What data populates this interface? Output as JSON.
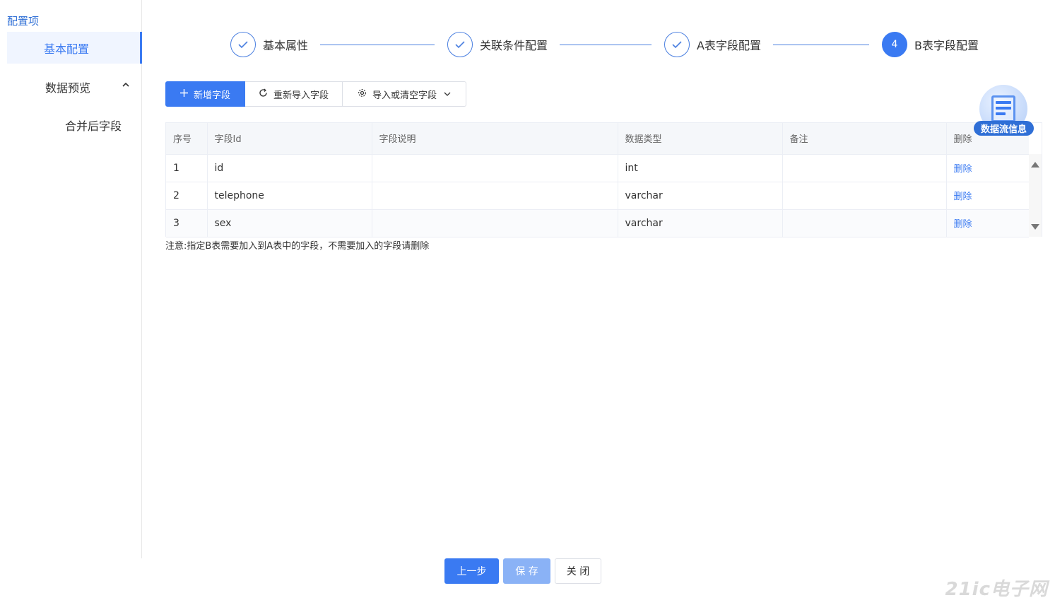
{
  "sidebar": {
    "heading": "配置项",
    "items": [
      {
        "label": "基本配置",
        "active": true
      },
      {
        "label": "数据预览",
        "expanded": true
      },
      {
        "label": "合并后字段"
      }
    ]
  },
  "steps": [
    {
      "label": "基本属性",
      "status": "done"
    },
    {
      "label": "关联条件配置",
      "status": "done"
    },
    {
      "label": "A表字段配置",
      "status": "done"
    },
    {
      "label": "B表字段配置",
      "status": "current",
      "number": "4"
    }
  ],
  "toolbar": {
    "add_label": "新增字段",
    "reimport_label": "重新导入字段",
    "import_label": "导入或清空字段"
  },
  "table": {
    "columns": [
      "序号",
      "字段Id",
      "字段说明",
      "数据类型",
      "备注",
      "删除"
    ],
    "rows": [
      {
        "index": "1",
        "field_id": "id",
        "desc": "",
        "type": "int",
        "remark": "",
        "action": "删除"
      },
      {
        "index": "2",
        "field_id": "telephone",
        "desc": "",
        "type": "varchar",
        "remark": "",
        "action": "删除"
      },
      {
        "index": "3",
        "field_id": "sex",
        "desc": "",
        "type": "varchar",
        "remark": "",
        "action": "删除"
      }
    ]
  },
  "note": "注意:指定B表需要加入到A表中的字段，不需要加入的字段请删除",
  "float_badge": {
    "label": "数据流信息",
    "icon": "document-list-icon"
  },
  "footer": {
    "prev_label": "上一步",
    "save_label": "保 存",
    "close_label": "关 闭"
  },
  "watermark": "21ic电子网",
  "colors": {
    "primary": "#3a7af2",
    "save_disabled": "#8ab2f6",
    "link": "#3a7af2"
  }
}
